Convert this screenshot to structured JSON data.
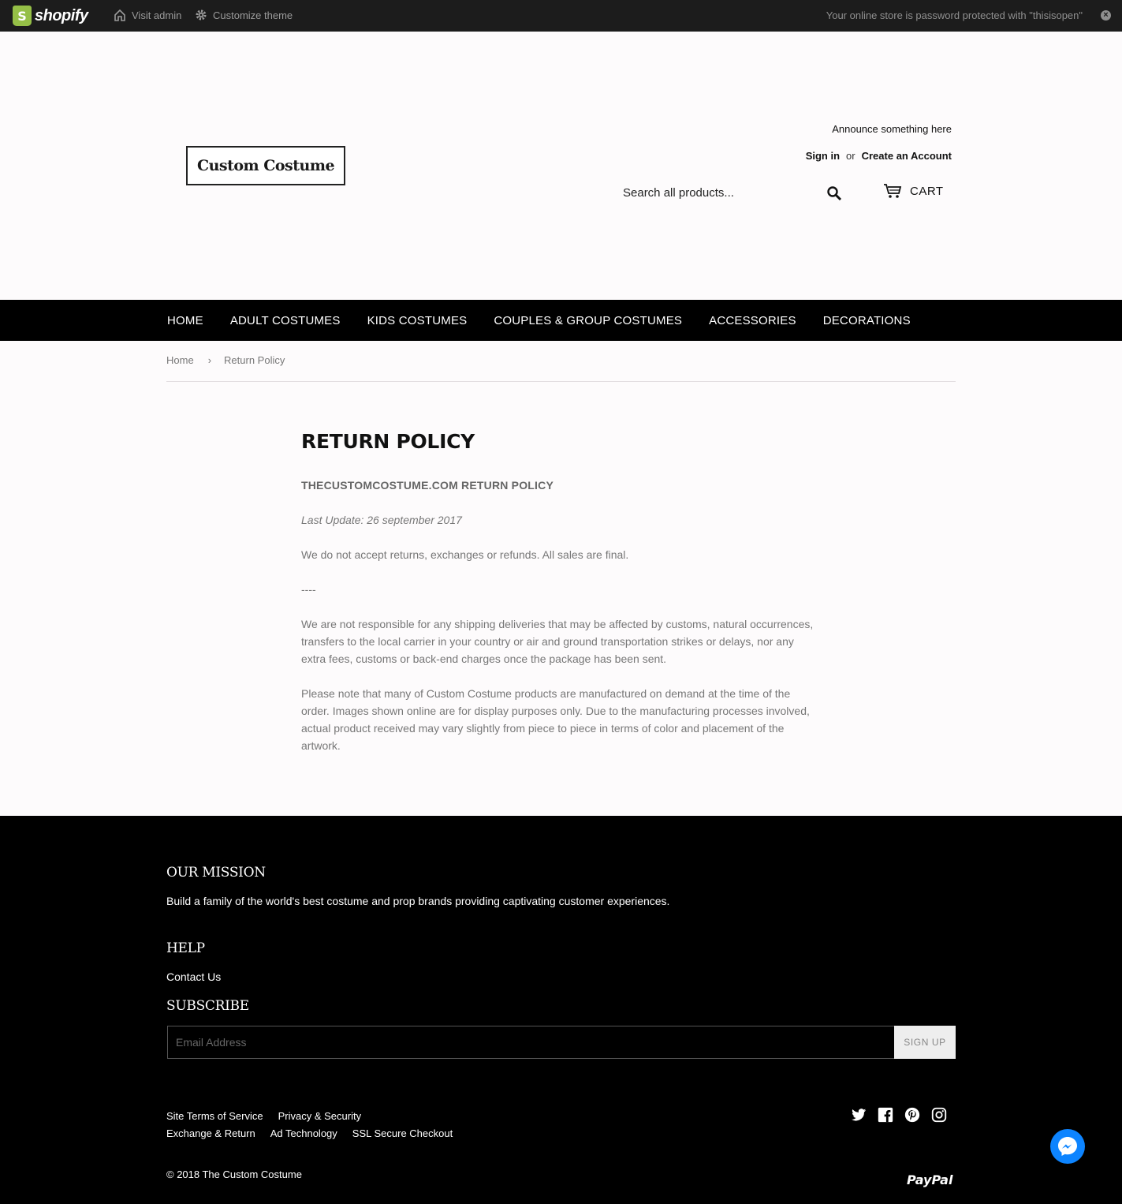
{
  "admin_bar": {
    "logo_text": "shopify",
    "visit_admin": "Visit admin",
    "customize_theme": "Customize theme",
    "notice": "Your online store is password protected with \"thisisopen\"",
    "close": "×"
  },
  "header": {
    "logo_text": "Custom Costume",
    "announcement": "Announce something here",
    "sign_in": "Sign in",
    "or": "or",
    "create_account": "Create an Account",
    "search_placeholder": "Search all products...",
    "cart_label": "CART"
  },
  "nav": {
    "items": [
      "HOME",
      "ADULT COSTUMES",
      "KIDS COSTUMES",
      "COUPLES & GROUP COSTUMES",
      "ACCESSORIES",
      "DECORATIONS"
    ]
  },
  "breadcrumb": {
    "home": "Home",
    "separator": "›",
    "current": "Return Policy"
  },
  "content": {
    "title": "RETURN POLICY",
    "subtitle": "THECUSTOMCOSTUME.COM RETURN POLICY",
    "last_update": "Last Update: 26 september 2017",
    "p1": "We do not accept returns, exchanges or refunds. All sales are final.",
    "divider": "----",
    "p2": "We are not responsible for any shipping deliveries that may be affected by customs, natural occurrences, transfers to the local carrier in your country or air and ground transportation strikes or delays, nor any extra fees, customs or back-end charges once the package has been sent.",
    "p3": "Please note that many of Custom Costume products are manufactured on demand at the time of the order. Images shown online are for display purposes only. Due to the manufacturing processes involved, actual product received may vary slightly from piece to piece in terms of color and placement of the artwork."
  },
  "footer": {
    "mission_title": "OUR MISSION",
    "mission_text": "Build a family of the world's best costume and prop brands providing captivating customer experiences.",
    "help_title": "HELP",
    "contact": "Contact Us",
    "subscribe_title": "SUBSCRIBE",
    "email_placeholder": "Email Address",
    "signup": "SIGN UP",
    "links_row1": [
      "Site Terms of Service",
      "Privacy & Security"
    ],
    "links_row2": [
      "Exchange & Return",
      "Ad Technology",
      "SSL Secure Checkout"
    ],
    "social": [
      "twitter-icon",
      "facebook-icon",
      "pinterest-icon",
      "instagram-icon"
    ],
    "copyright": "© 2018 The Custom Costume",
    "payment": "PayPal"
  },
  "colors": {
    "admin_bar": "#1c1c1c",
    "shopify_green": "#95bf47",
    "nav_bg": "#000000",
    "page_bg": "#fdfbfc",
    "messenger_blue": "#0d84ff"
  }
}
